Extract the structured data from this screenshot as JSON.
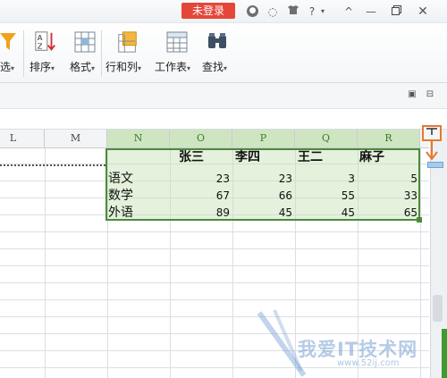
{
  "titlebar": {
    "login_label": "未登录",
    "icons": [
      "feedback-icon",
      "skin-icon",
      "shirt-icon",
      "help-icon",
      "collapse-icon",
      "minimize-icon",
      "restore-icon",
      "close-icon"
    ],
    "help_label": "?"
  },
  "ribbon": {
    "items": [
      {
        "label": "选",
        "icon": "filter-icon"
      },
      {
        "label": "排序",
        "icon": "sort-icon"
      },
      {
        "label": "格式",
        "icon": "format-icon"
      },
      {
        "label": "行和列",
        "icon": "rows-columns-icon"
      },
      {
        "label": "工作表",
        "icon": "worksheet-icon"
      },
      {
        "label": "查找",
        "icon": "find-icon"
      }
    ]
  },
  "columns": [
    {
      "label": "L"
    },
    {
      "label": "M"
    },
    {
      "label": "N"
    },
    {
      "label": "O"
    },
    {
      "label": "P"
    },
    {
      "label": "Q"
    },
    {
      "label": "R"
    }
  ],
  "table": {
    "headers": [
      "张三",
      "李四",
      "王二",
      "麻子"
    ],
    "rows": [
      {
        "label": "语文",
        "values": [
          "23",
          "23",
          "3",
          "5"
        ]
      },
      {
        "label": "数学",
        "values": [
          "67",
          "66",
          "55",
          "33"
        ]
      },
      {
        "label": "外语",
        "values": [
          "89",
          "45",
          "45",
          "65"
        ]
      }
    ]
  },
  "watermark": {
    "text": "我爱IT技术网",
    "url": "www.52ij.com"
  },
  "colors": {
    "login": "#e4473a",
    "selection_border": "#4c8b3c",
    "selection_fill": "#c4e1b2",
    "split_highlight": "#e8782e"
  }
}
